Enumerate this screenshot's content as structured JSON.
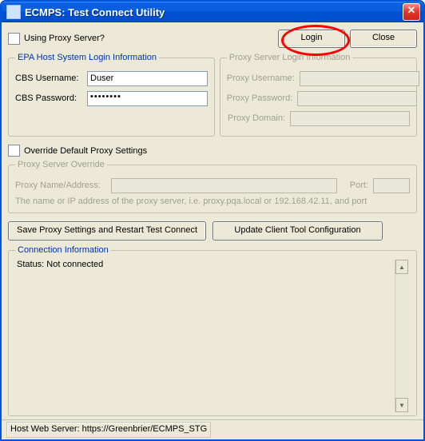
{
  "window": {
    "title": "ECMPS: Test Connect Utility"
  },
  "top": {
    "using_proxy_label": "Using Proxy Server?",
    "login_label": "Login",
    "close_label": "Close"
  },
  "epa_login": {
    "legend": "EPA Host System Login Information",
    "username_label": "CBS Username:",
    "username_value": "Duser",
    "password_label": "CBS Password:",
    "password_mask": "••••••••"
  },
  "proxy_login": {
    "legend": "Proxy Server Login Information",
    "username_label": "Proxy Username:",
    "password_label": "Proxy Password:",
    "domain_label": "Proxy Domain:"
  },
  "override": {
    "checkbox_label": "Override Default Proxy Settings",
    "legend": "Proxy Server Override",
    "name_label": "Proxy Name/Address:",
    "port_label": "Port:",
    "helper": "The name or IP address of the proxy server, i.e. proxy.pqa.local or 192.168.42.11, and port"
  },
  "action_buttons": {
    "save_proxy": "Save Proxy Settings and Restart Test Connect",
    "update_tool": "Update Client Tool Configuration"
  },
  "connection": {
    "legend": "Connection Information",
    "status_text": "Status: Not connected"
  },
  "statusbar": {
    "host": "Host Web Server: https://Greenbrier/ECMPS_STG"
  }
}
